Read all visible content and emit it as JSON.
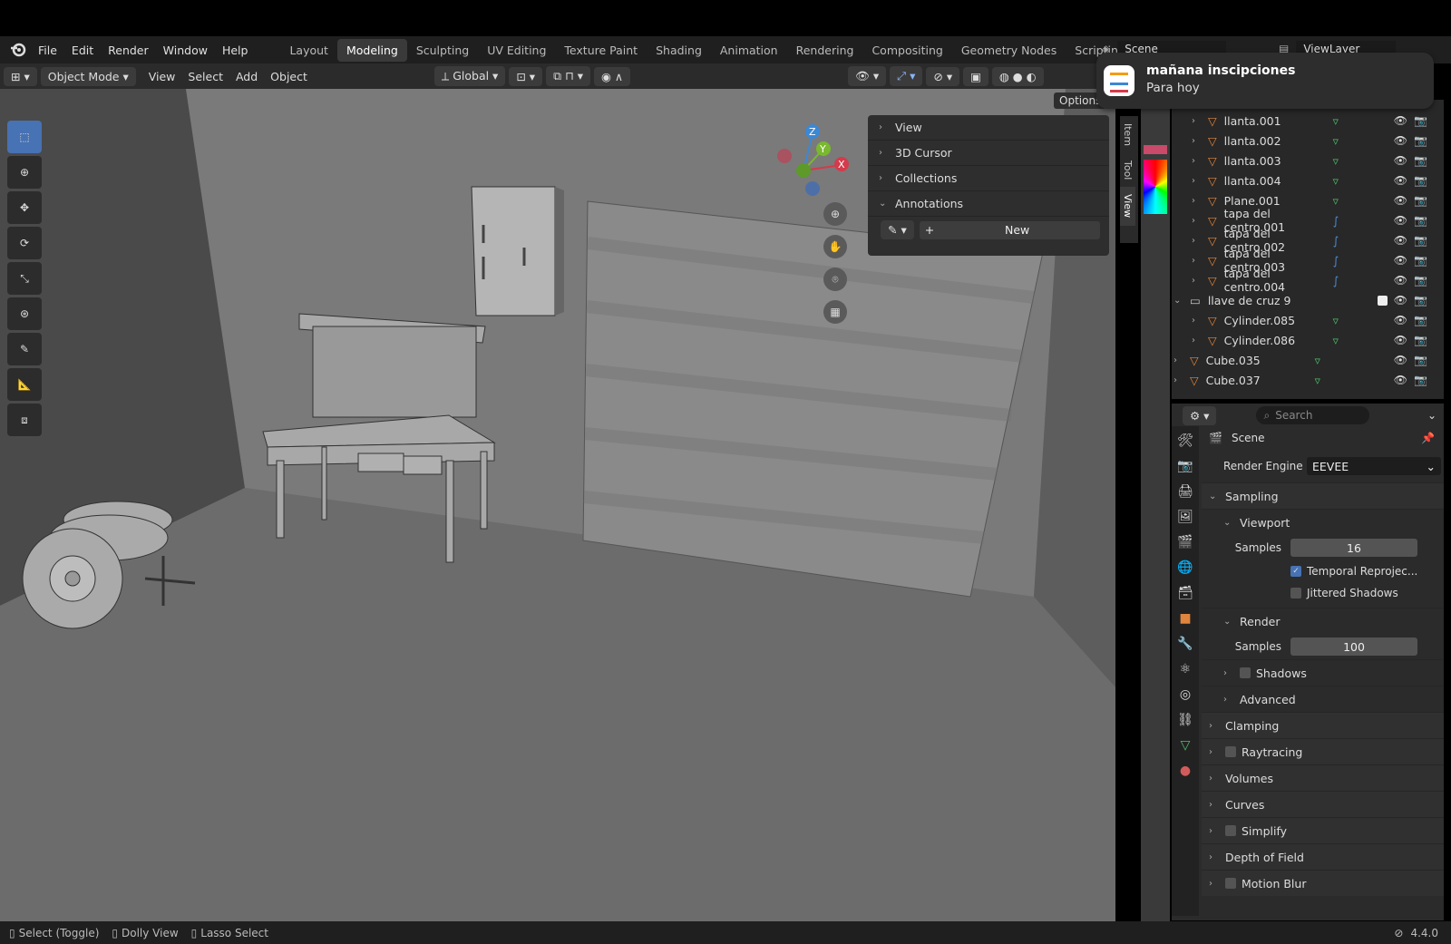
{
  "menus": [
    "File",
    "Edit",
    "Render",
    "Window",
    "Help"
  ],
  "workspaces": [
    {
      "label": "Layout",
      "active": false
    },
    {
      "label": "Modeling",
      "active": true
    },
    {
      "label": "Sculpting",
      "active": false
    },
    {
      "label": "UV Editing",
      "active": false
    },
    {
      "label": "Texture Paint",
      "active": false
    },
    {
      "label": "Shading",
      "active": false
    },
    {
      "label": "Animation",
      "active": false
    },
    {
      "label": "Rendering",
      "active": false
    },
    {
      "label": "Compositing",
      "active": false
    },
    {
      "label": "Geometry Nodes",
      "active": false
    },
    {
      "label": "Scripting",
      "active": false
    }
  ],
  "add_workspace": "+",
  "scene_name": "Scene",
  "view_layer": "ViewLayer",
  "header": {
    "mode": "Object Mode",
    "view": "View",
    "select": "Select",
    "add": "Add",
    "object": "Object",
    "transform_orientation": "Global",
    "options": "Options"
  },
  "notification": {
    "title": "mañana inscipciones",
    "subtitle": "Para hoy"
  },
  "npanel": {
    "sections": [
      "View",
      "3D Cursor",
      "Collections",
      "Annotations"
    ],
    "new_button": "New"
  },
  "side_tabs": [
    "Item",
    "Tool",
    "View"
  ],
  "gizmo": {
    "x": "X",
    "y": "Y",
    "z": "Z"
  },
  "outliner": [
    {
      "name": "llanta.001",
      "indent": 2,
      "type": "mesh"
    },
    {
      "name": "llanta.002",
      "indent": 2,
      "type": "mesh"
    },
    {
      "name": "llanta.003",
      "indent": 2,
      "type": "mesh"
    },
    {
      "name": "llanta.004",
      "indent": 2,
      "type": "mesh"
    },
    {
      "name": "Plane.001",
      "indent": 2,
      "type": "mesh"
    },
    {
      "name": "tapa del centro.001",
      "indent": 2,
      "type": "curve"
    },
    {
      "name": "tapa del centro.002",
      "indent": 2,
      "type": "curve"
    },
    {
      "name": "tapa del centro.003",
      "indent": 2,
      "type": "curve"
    },
    {
      "name": "tapa del centro.004",
      "indent": 2,
      "type": "curve"
    },
    {
      "name": "llave de cruz 9",
      "indent": 1,
      "type": "collection"
    },
    {
      "name": "Cylinder.085",
      "indent": 2,
      "type": "mesh"
    },
    {
      "name": "Cylinder.086",
      "indent": 2,
      "type": "mesh"
    },
    {
      "name": "Cube.035",
      "indent": 1,
      "type": "mesh"
    },
    {
      "name": "Cube.037",
      "indent": 1,
      "type": "mesh"
    }
  ],
  "properties": {
    "search_placeholder": "Search",
    "context": "Scene",
    "render_engine_label": "Render Engine",
    "render_engine": "EEVEE",
    "sampling": "Sampling",
    "viewport": "Viewport",
    "samples_label": "Samples",
    "viewport_samples": "16",
    "temporal_reprojection": "Temporal Reprojec...",
    "jittered_shadows": "Jittered Shadows",
    "render": "Render",
    "render_samples": "100",
    "shadows": "Shadows",
    "advanced": "Advanced",
    "sections": [
      "Clamping",
      "Raytracing",
      "Volumes",
      "Curves",
      "Simplify",
      "Depth of Field",
      "Motion Blur"
    ]
  },
  "status": {
    "select": "Select (Toggle)",
    "dolly": "Dolly View",
    "lasso": "Lasso Select",
    "version": "4.4.0"
  },
  "colors": {
    "accent": "#4772b3",
    "mesh_icon": "#e0853d",
    "vert_icon": "#4fbf6b",
    "x_axis": "#d43b4b",
    "y_axis": "#7ab830",
    "z_axis": "#3b88d4"
  }
}
